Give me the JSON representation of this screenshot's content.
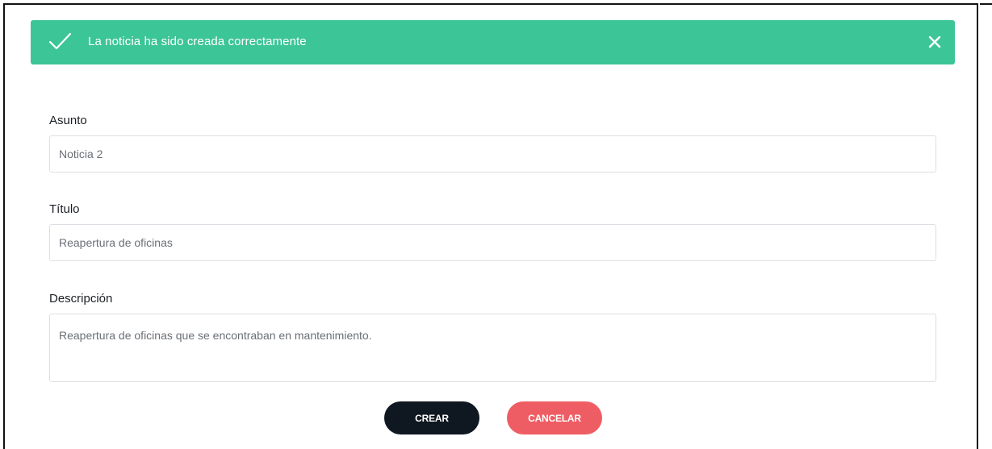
{
  "alert": {
    "message": "La noticia ha sido creada correctamente",
    "color": "#3cc596",
    "icon": "check-icon",
    "close_icon": "close-icon"
  },
  "form": {
    "subject": {
      "label": "Asunto",
      "value": "Noticia 2"
    },
    "title": {
      "label": "Título",
      "value": "Reapertura de oficinas"
    },
    "description": {
      "label": "Descripción",
      "value": "Reapertura de oficinas que se encontraban en mantenimiento."
    }
  },
  "actions": {
    "create_label": "CREAR",
    "cancel_label": "CANCELAR",
    "create_color": "#0f1720",
    "cancel_color": "#ee5d63"
  }
}
